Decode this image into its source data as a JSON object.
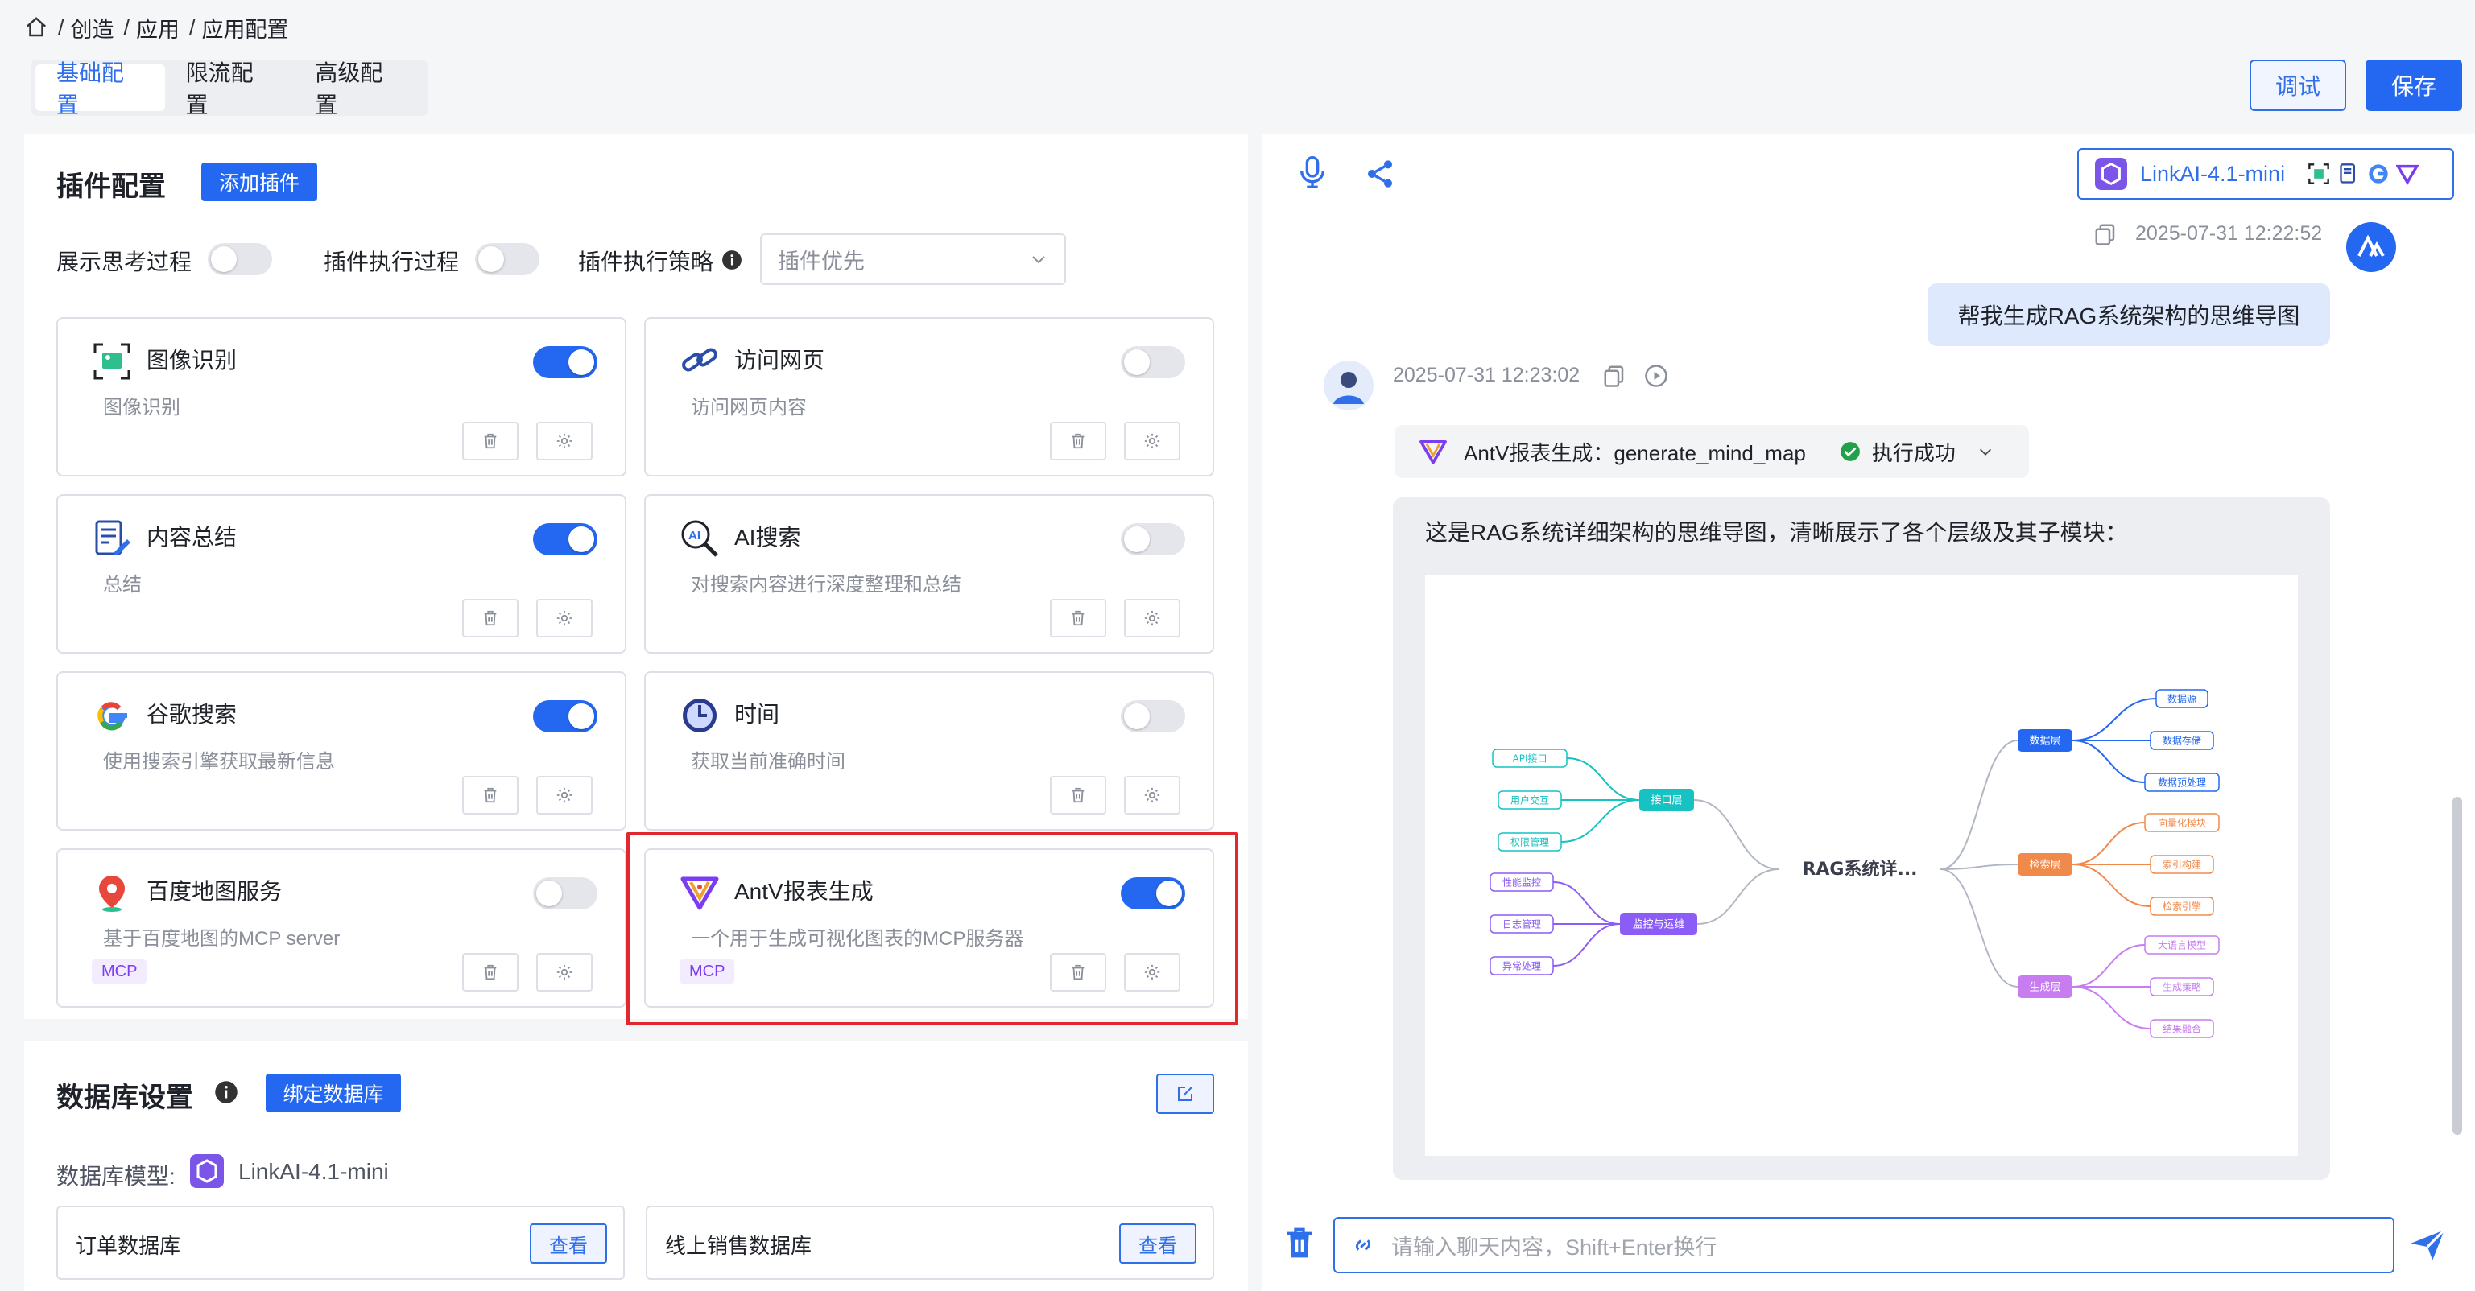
{
  "breadcrumb": {
    "items": [
      "创造",
      "应用",
      "应用配置"
    ]
  },
  "tabs": [
    {
      "label": "基础配置",
      "active": true
    },
    {
      "label": "限流配置",
      "active": false
    },
    {
      "label": "高级配置",
      "active": false
    }
  ],
  "header_actions": {
    "debug_label": "调试",
    "save_label": "保存"
  },
  "plugins": {
    "title": "插件配置",
    "add_label": "添加插件",
    "show_thinking_label": "展示思考过程",
    "show_thinking_on": false,
    "exec_process_label": "插件执行过程",
    "exec_process_on": false,
    "strategy_label": "插件执行策略",
    "strategy_value": "插件优先",
    "cards": [
      {
        "name": "图像识别",
        "desc": "图像识别",
        "on": true,
        "icon": "image-recognition-icon"
      },
      {
        "name": "访问网页",
        "desc": "访问网页内容",
        "on": false,
        "icon": "link-icon"
      },
      {
        "name": "内容总结",
        "desc": "总结",
        "on": true,
        "icon": "summary-icon"
      },
      {
        "name": "AI搜索",
        "desc": "对搜索内容进行深度整理和总结",
        "on": false,
        "icon": "ai-search-icon"
      },
      {
        "name": "谷歌搜索",
        "desc": "使用搜索引擎获取最新信息",
        "on": true,
        "icon": "google-icon"
      },
      {
        "name": "时间",
        "desc": "获取当前准确时间",
        "on": false,
        "icon": "clock-icon"
      },
      {
        "name": "百度地图服务",
        "desc": "基于百度地图的MCP server",
        "on": false,
        "icon": "map-pin-icon",
        "badge": "MCP"
      },
      {
        "name": "AntV报表生成",
        "desc": "一个用于生成可视化图表的MCP服务器",
        "on": true,
        "icon": "antv-icon",
        "badge": "MCP"
      }
    ]
  },
  "database": {
    "title": "数据库设置",
    "bind_label": "绑定数据库",
    "model_label": "数据库模型:",
    "model_name": "LinkAI-4.1-mini",
    "dbs": [
      {
        "name": "订单数据库",
        "view": "查看"
      },
      {
        "name": "线上销售数据库",
        "view": "查看"
      }
    ]
  },
  "chat": {
    "model_name": "LinkAI-4.1-mini",
    "user_time": "2025-07-31 12:22:52",
    "user_message": "帮我生成RAG系统架构的思维导图",
    "bot_time": "2025-07-31 12:23:02",
    "tool_call": "AntV报表生成：generate_mind_map",
    "tool_status": "执行成功",
    "reply_text": "这是RAG系统详细架构的思维导图，清晰展示了各个层级及其子模块：",
    "input_placeholder": "请输入聊天内容，Shift+Enter换行"
  },
  "mindmap": {
    "root": "RAG系统详...",
    "branches": [
      {
        "label": "数据层",
        "color": "#2468f2",
        "children": [
          "数据源",
          "数据存储",
          "数据预处理"
        ]
      },
      {
        "label": "检索层",
        "color": "#f08a4b",
        "children": [
          "向量化模块",
          "索引构建",
          "检索引擎"
        ]
      },
      {
        "label": "生成层",
        "color": "#c77cf0",
        "children": [
          "大语言模型",
          "生成策略",
          "结果融合"
        ]
      },
      {
        "label": "接口层",
        "color": "#16c2c2",
        "children": [
          "API接口",
          "用户交互",
          "权限管理"
        ]
      },
      {
        "label": "监控与运维",
        "color": "#8b5cf6",
        "children": [
          "性能监控",
          "日志管理",
          "异常处理"
        ]
      }
    ]
  }
}
